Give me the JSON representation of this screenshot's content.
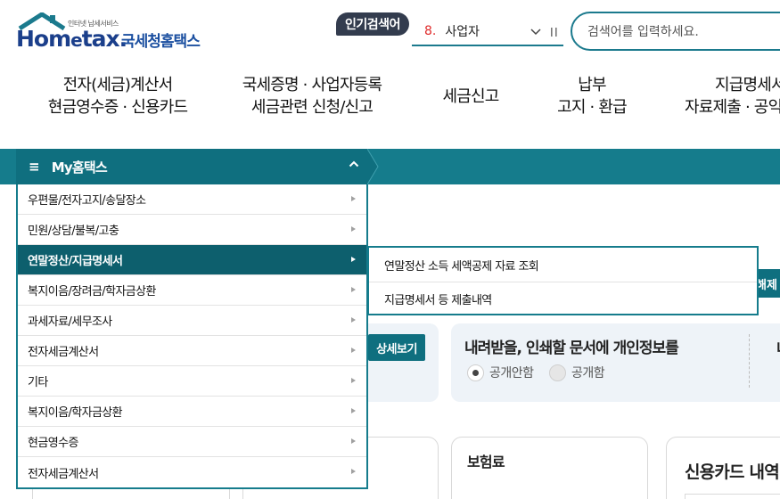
{
  "logo": {
    "small_text": "인터넷 납세서비스",
    "brand_pre": "Hom",
    "brand_e": "e",
    "brand_post": "tax.",
    "agency": "국세청홈택스"
  },
  "popular_search": {
    "badge": "인기검색어",
    "rank": "8.",
    "term": "사업자"
  },
  "search": {
    "placeholder": "검색어를 입력하세요."
  },
  "main_nav": [
    {
      "line1": "전자(세금)계산서",
      "line2": "현금영수증 · 신용카드"
    },
    {
      "line1": "국세증명 · 사업자등록",
      "line2": "세금관련 신청/신고"
    },
    {
      "line1": "세금신고",
      "line2": ""
    },
    {
      "line1": "납부",
      "line2": "고지 · 환급"
    },
    {
      "line1": "지급명세서",
      "line2": "자료제출 · 공익"
    }
  ],
  "my_hometax": {
    "title": "My홈택스"
  },
  "dropdown_items": [
    {
      "label": "우편물/전자고지/송달장소"
    },
    {
      "label": "민원/상담/불복/고충"
    },
    {
      "label": "연말정산/지급명세서"
    },
    {
      "label": "복지이음/장려금/학자금상환"
    },
    {
      "label": "과세자료/세무조사"
    },
    {
      "label": "전자세금계산서"
    },
    {
      "label": "기타"
    },
    {
      "label": "복지이음/학자금상환"
    },
    {
      "label": "현금영수증"
    },
    {
      "label": "전자세금계산서"
    }
  ],
  "active_item_index": 2,
  "submenu_items": [
    {
      "label": "연말정산 소득 세액공제 자료 조회"
    },
    {
      "label": "지급명세서 등 제출내역"
    }
  ],
  "background": {
    "right_button": "해제",
    "detail_button": "상세보기",
    "privacy_title": "내려받을, 인쇄할 문서에 개인정보를",
    "privacy_next_char": "내",
    "radio_private": "공개안함",
    "radio_public": "공개함",
    "card_insurance": "보험료",
    "card_credit": "신용카드 내역"
  },
  "colors": {
    "teal": "#157c8c",
    "teal_dark": "#0d5f6d",
    "navy_badge": "#333c4e",
    "brand_blue": "#1b3f8b",
    "rank_red": "#e02b2b"
  }
}
